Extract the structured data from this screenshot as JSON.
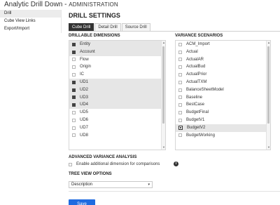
{
  "app": {
    "title": "Analytic Drill Down",
    "separator": " - ",
    "subtitle": "ADMINISTRATION"
  },
  "sidebar": {
    "items": [
      {
        "label": "Drill",
        "active": true
      },
      {
        "label": "Cube View Links",
        "active": false
      },
      {
        "label": "Export/Import",
        "active": false
      }
    ]
  },
  "main": {
    "title": "DRILL SETTINGS",
    "tabs": [
      {
        "label": "Cube Drill",
        "active": true
      },
      {
        "label": "Detail Drill",
        "active": false
      },
      {
        "label": "Source Drill",
        "active": false
      }
    ],
    "drillable_dimensions": {
      "heading": "DRILLABLE DIMENSIONS",
      "items": [
        {
          "label": "Entity",
          "checked": true
        },
        {
          "label": "Account",
          "checked": true
        },
        {
          "label": "Flow",
          "checked": false
        },
        {
          "label": "Origin",
          "checked": false
        },
        {
          "label": "IC",
          "checked": false
        },
        {
          "label": "UD1",
          "checked": true
        },
        {
          "label": "UD2",
          "checked": true
        },
        {
          "label": "UD3",
          "checked": true
        },
        {
          "label": "UD4",
          "checked": true
        },
        {
          "label": "UD5",
          "checked": false
        },
        {
          "label": "UD6",
          "checked": false
        },
        {
          "label": "UD7",
          "checked": false
        },
        {
          "label": "UD8",
          "checked": false
        }
      ]
    },
    "variance_scenarios": {
      "heading": "VARIANCE SCENARIOS",
      "items": [
        {
          "label": "ACM_Import",
          "checked": false
        },
        {
          "label": "Actual",
          "checked": false
        },
        {
          "label": "ActualAR",
          "checked": false
        },
        {
          "label": "ActualBud",
          "checked": false
        },
        {
          "label": "ActualPrior",
          "checked": false
        },
        {
          "label": "ActualTXM",
          "checked": false
        },
        {
          "label": "BalanceSheetModel",
          "checked": false
        },
        {
          "label": "Baseline",
          "checked": false
        },
        {
          "label": "BestCase",
          "checked": false
        },
        {
          "label": "BudgetFinal",
          "checked": false
        },
        {
          "label": "BudgetV1",
          "checked": false
        },
        {
          "label": "BudgetV2",
          "checked": true
        },
        {
          "label": "BudgetWorking",
          "checked": false
        }
      ]
    },
    "advanced": {
      "heading": "ADVANCED VARIANCE ANALYSIS",
      "option_label": "Enable additional dimension for comparisons",
      "option_checked": false,
      "info_glyph": "i"
    },
    "tree_view": {
      "heading": "TREE VIEW OPTIONS",
      "selected": "Description",
      "caret": "▾"
    },
    "save_label": "Save"
  },
  "colors": {
    "accent": "#1f6be0",
    "active_tab": "#333333",
    "selected_row": "#e6e6e6"
  }
}
